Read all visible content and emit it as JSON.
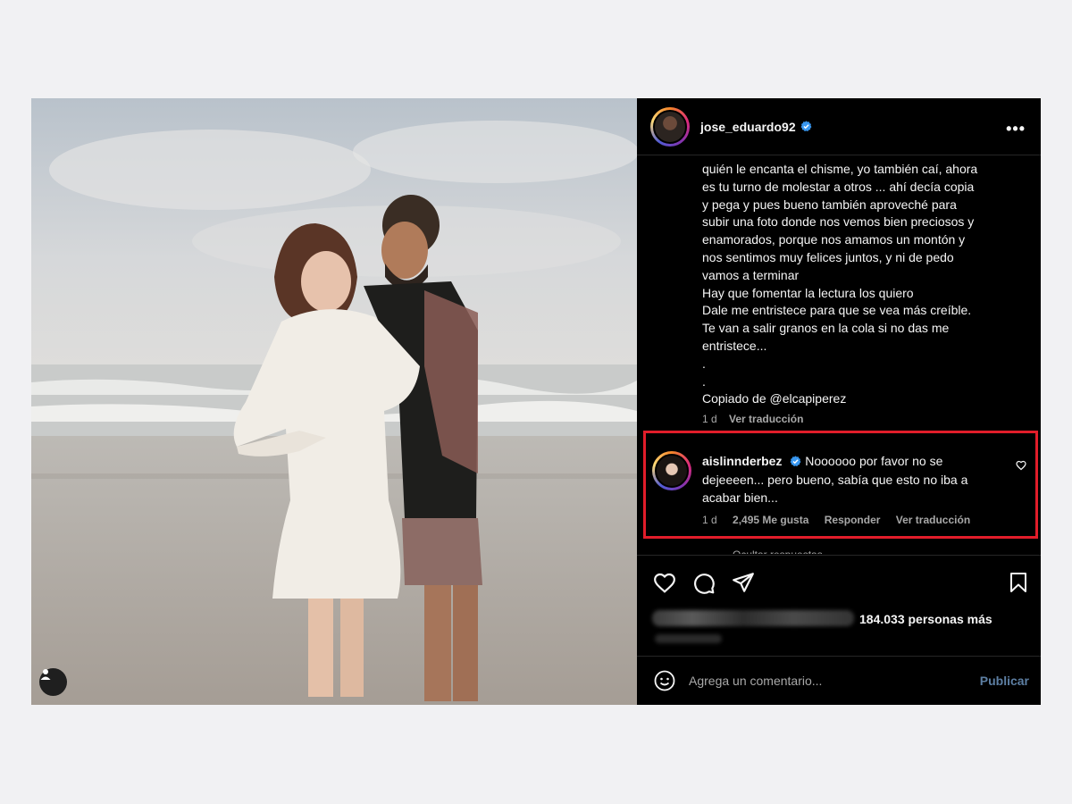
{
  "post": {
    "username": "jose_eduardo92",
    "caption_lines": [
      "quién le encanta el chisme, yo también caí, ahora",
      "es tu turno de molestar a otros ... ahí decía copia",
      "y pega y pues bueno también aproveché para",
      "subir una foto donde nos vemos bien preciosos y",
      "enamorados, porque nos amamos un montón y",
      "nos sentimos muy felices juntos, y ni de pedo",
      "vamos a terminar",
      "Hay que fomentar la lectura los quiero",
      "Dale me entristece para que se vea más creíble.",
      "Te van a salir granos en la cola si no das me",
      "entristece...",
      ".",
      ".",
      "Copiado de @elcapiperez"
    ],
    "caption_age": "1 d",
    "translate_label": "Ver traducción"
  },
  "comment": {
    "username": "aislinnderbez",
    "text_line_1": "Noooooo por favor no se",
    "text_line_2": "dejeeeen... pero bueno, sabía que esto no iba a",
    "text_line_3": "acabar bien...",
    "age": "1 d",
    "likes": "2,495 Me gusta",
    "reply_label": "Responder",
    "translate_label": "Ver traducción",
    "hidden_replies": "Ocultar respuestas"
  },
  "likes_summary": "184.033 personas más",
  "add_comment": {
    "placeholder": "Agrega un comentario...",
    "publish_label": "Publicar"
  },
  "colors": {
    "highlight_border": "#e11d2a",
    "publish_disabled": "#5d7fa3",
    "verified_badge": "#3897f0"
  },
  "icons": [
    "more-icon",
    "verified-icon",
    "heart-icon",
    "comment-icon",
    "share-icon",
    "bookmark-icon",
    "emoji-icon",
    "user-tag-icon"
  ]
}
